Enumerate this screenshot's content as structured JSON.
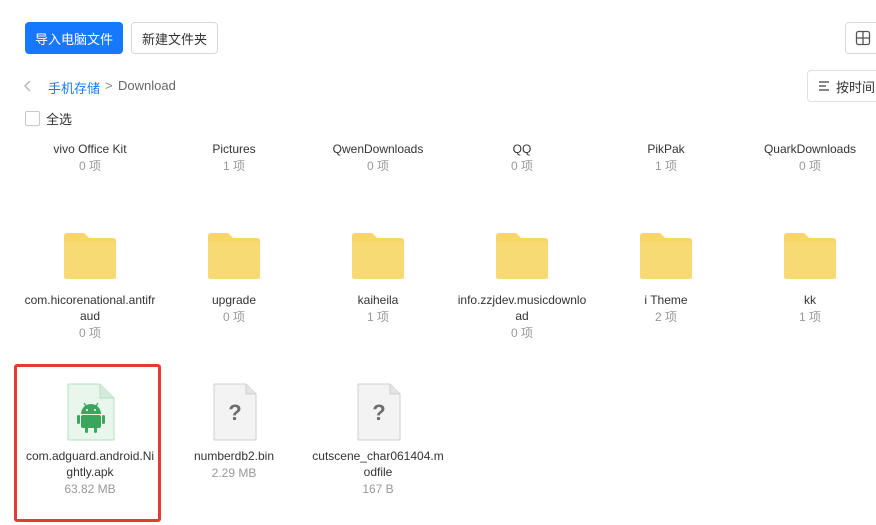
{
  "toolbar": {
    "import_label": "导入电脑文件",
    "new_folder_label": "新建文件夹"
  },
  "breadcrumb": {
    "root": "手机存储",
    "separator": ">",
    "current": "Download"
  },
  "sort": {
    "label": "按时间"
  },
  "select_all": {
    "label": "全选"
  },
  "items": [
    {
      "name": "vivo Office Kit",
      "meta": "0 项",
      "type": "folder"
    },
    {
      "name": "Pictures",
      "meta": "1 项",
      "type": "folder"
    },
    {
      "name": "QwenDownloads",
      "meta": "0 项",
      "type": "folder"
    },
    {
      "name": "QQ",
      "meta": "0 项",
      "type": "folder"
    },
    {
      "name": "PikPak",
      "meta": "1 项",
      "type": "folder"
    },
    {
      "name": "QuarkDownloads",
      "meta": "0 项",
      "type": "folder"
    },
    {
      "name": "com.hicorenational.antifraud",
      "meta": "0 项",
      "type": "folder"
    },
    {
      "name": "upgrade",
      "meta": "0 项",
      "type": "folder"
    },
    {
      "name": "kaiheila",
      "meta": "1 项",
      "type": "folder"
    },
    {
      "name": "info.zzjdev.musicdownload",
      "meta": "0 项",
      "type": "folder"
    },
    {
      "name": "i Theme",
      "meta": "2 项",
      "type": "folder"
    },
    {
      "name": "kk",
      "meta": "1 项",
      "type": "folder"
    },
    {
      "name": "com.adguard.android.Nightly.apk",
      "meta": "63.82 MB",
      "type": "apk"
    },
    {
      "name": "numberdb2.bin",
      "meta": "2.29 MB",
      "type": "unknown"
    },
    {
      "name": "cutscene_char061404.modfile",
      "meta": "167 B",
      "type": "unknown"
    }
  ],
  "colors": {
    "accent": "#1677ff",
    "folder": "#f7d569",
    "apk_bg": "#e8f6ec",
    "android": "#3ca55c",
    "highlight": "#e53935"
  },
  "icons": {
    "folder": "folder-icon",
    "apk": "android-apk-icon",
    "unknown": "unknown-file-icon"
  }
}
